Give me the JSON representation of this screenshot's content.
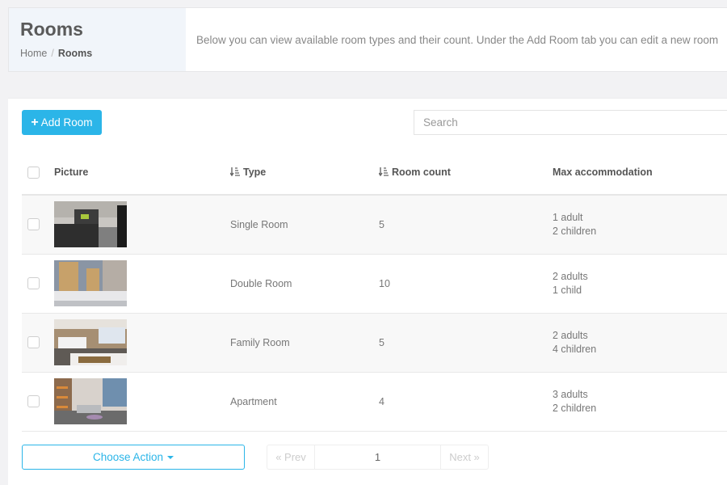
{
  "header": {
    "title": "Rooms",
    "breadcrumb": {
      "home": "Home",
      "separator": "/",
      "current": "Rooms"
    },
    "description": "Below you can view available room types and their count. Under the Add Room tab you can edit a new room"
  },
  "toolbar": {
    "add_label": "Add Room",
    "add_icon": "plus-icon",
    "search_placeholder": "Search",
    "search_value": "",
    "accent_color": "#2bb5e8"
  },
  "table": {
    "columns": [
      {
        "label": "Picture",
        "sortable": false
      },
      {
        "label": "Type",
        "sortable": true,
        "icon": "sort-amount-down-icon"
      },
      {
        "label": "Room count",
        "sortable": true,
        "icon": "sort-amount-down-icon"
      },
      {
        "label": "Max accommodation",
        "sortable": false
      }
    ],
    "rows": [
      {
        "picture": "single-room-photo",
        "type": "Single Room",
        "count": "5",
        "adults": "1 adult",
        "children": "2 children",
        "checked": false
      },
      {
        "picture": "double-room-photo",
        "type": "Double Room",
        "count": "10",
        "adults": "2 adults",
        "children": "1 child",
        "checked": false
      },
      {
        "picture": "family-room-photo",
        "type": "Family Room",
        "count": "5",
        "adults": "2 adults",
        "children": "4 children",
        "checked": false
      },
      {
        "picture": "apartment-photo",
        "type": "Apartment",
        "count": "4",
        "adults": "3 adults",
        "children": "2 children",
        "checked": false
      }
    ]
  },
  "footer": {
    "action_label": "Choose Action",
    "pagination": {
      "prev": "« Prev",
      "current_page": "1",
      "next": "Next »"
    }
  }
}
